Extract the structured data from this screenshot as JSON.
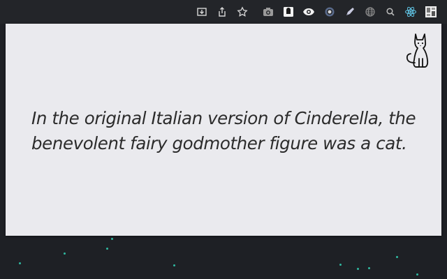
{
  "toolbar": {
    "icons": [
      "install-app-icon",
      "share-icon",
      "bookmark-star-icon",
      "camera-icon",
      "dark-reader-icon",
      "eye-icon",
      "ring-icon",
      "pen-icon",
      "globe-icon",
      "search-icon",
      "react-icon",
      "extension-profile-icon"
    ]
  },
  "fact": {
    "line1": "In the original Italian version of Cinderella, the",
    "line2": "benevolent fairy godmother figure was a cat."
  },
  "colors": {
    "page_bg": "#1e2025",
    "popup_bg": "#eaeaee",
    "text": "#2b2b2b",
    "star_accent": "#2fb8a0"
  }
}
